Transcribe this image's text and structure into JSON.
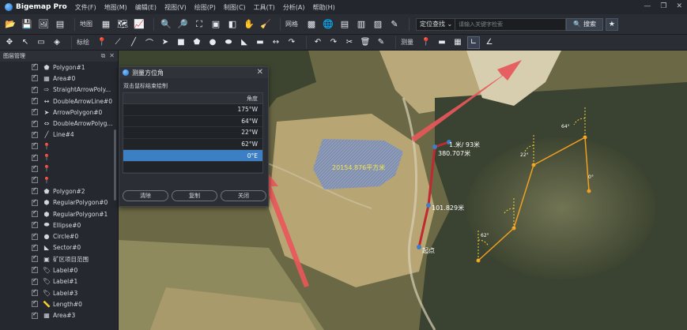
{
  "app": {
    "title": "Bigemap Pro",
    "menus": [
      "文件(F)",
      "地图(M)",
      "编辑(E)",
      "视图(V)",
      "绘图(P)",
      "制图(C)",
      "工具(T)",
      "分析(A)",
      "帮助(H)"
    ],
    "window_controls": [
      "—",
      "❐",
      "✕"
    ]
  },
  "toolbar1": {
    "map_label": "地图",
    "grid_label": "网格",
    "search_mode": "定位查找",
    "search_placeholder": "请输入关键字检索",
    "search_button": "搜索"
  },
  "toolbar2": {
    "mark_label": "标绘",
    "measure_label": "测量"
  },
  "layer_panel": {
    "title": "图层管理",
    "controls": [
      "⧉",
      "✕"
    ],
    "layers": [
      {
        "icon": "polygon-icon",
        "glyph": "⬟",
        "name": "Polygon#1"
      },
      {
        "icon": "area-icon",
        "glyph": "▦",
        "name": "Area#0"
      },
      {
        "icon": "straight-arrow-icon",
        "glyph": "⇨",
        "name": "StraightArrowPoly..."
      },
      {
        "icon": "double-arrow-line-icon",
        "glyph": "↔",
        "name": "DoubleArrowLine#0"
      },
      {
        "icon": "arrow-polygon-icon",
        "glyph": "➤",
        "name": "ArrowPolygon#0"
      },
      {
        "icon": "double-arrow-polygon-icon",
        "glyph": "⇔",
        "name": "DoubleArrowPolyg..."
      },
      {
        "icon": "line-icon",
        "glyph": "╱",
        "name": "Line#4"
      },
      {
        "icon": "marker-icon",
        "glyph": "📍",
        "name": ""
      },
      {
        "icon": "marker-icon",
        "glyph": "📍",
        "name": ""
      },
      {
        "icon": "marker-icon",
        "glyph": "📍",
        "name": ""
      },
      {
        "icon": "marker-icon",
        "glyph": "📍",
        "name": ""
      },
      {
        "icon": "polygon-icon",
        "glyph": "⬟",
        "name": "Polygon#2"
      },
      {
        "icon": "regular-polygon-icon",
        "glyph": "⬢",
        "name": "RegularPolygon#0"
      },
      {
        "icon": "regular-polygon-icon",
        "glyph": "⬢",
        "name": "RegularPolygon#1"
      },
      {
        "icon": "ellipse-icon",
        "glyph": "⬬",
        "name": "Ellipse#0"
      },
      {
        "icon": "circle-icon",
        "glyph": "●",
        "name": "Circle#0"
      },
      {
        "icon": "sector-icon",
        "glyph": "◣",
        "name": "Sector#0"
      },
      {
        "icon": "mining-area-icon",
        "glyph": "▣",
        "name": "矿区项目范围"
      },
      {
        "icon": "label-icon",
        "glyph": "🏷",
        "name": "Label#0"
      },
      {
        "icon": "label-icon",
        "glyph": "🏷",
        "name": "Label#1"
      },
      {
        "icon": "label-icon",
        "glyph": "🏷",
        "name": "Label#3"
      },
      {
        "icon": "length-icon",
        "glyph": "📏",
        "name": "Length#0"
      },
      {
        "icon": "area-icon",
        "glyph": "▦",
        "name": "Area#3"
      }
    ]
  },
  "dialog": {
    "title": "测量方位角",
    "hint": "双击鼠标结束绘制",
    "column_header": "角度",
    "angles": [
      "175°W",
      "64°W",
      "22°W",
      "62°W",
      "0°E"
    ],
    "selected_index": 4,
    "buttons": {
      "clear": "清除",
      "copy": "复制",
      "close": "关闭"
    }
  },
  "map_labels": {
    "area_label": "20154.876平方米",
    "segment1": "101.829米",
    "segment2_line1": "1.米/ 93米",
    "segment2_line2": "380.707米",
    "start": "起点",
    "angle_a": "64°",
    "angle_b": "0°",
    "angle_c": "62°",
    "angle_d": "22°"
  },
  "colors": {
    "accent": "#3d7fc5",
    "measure_line": "#c0292f",
    "angle_line": "#f0a020",
    "arrow": "#e8575a",
    "area_fill": "#5a7fd6"
  }
}
